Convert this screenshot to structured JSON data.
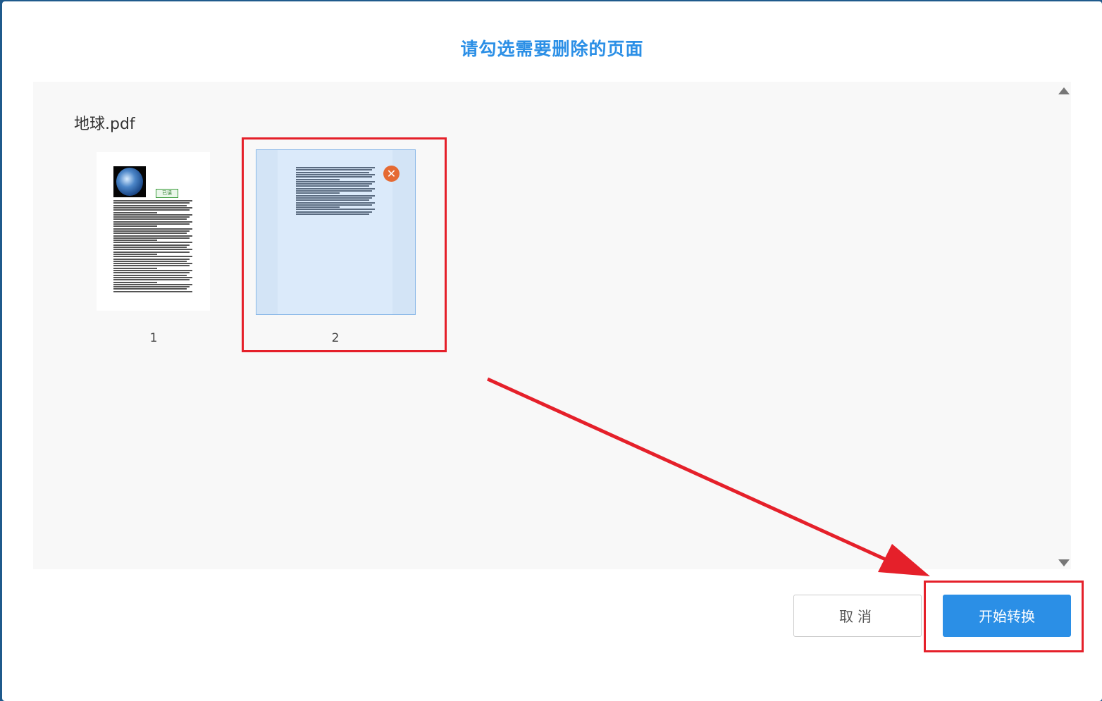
{
  "dialog": {
    "title": "请勾选需要删除的页面"
  },
  "file": {
    "name": "地球.pdf",
    "pages": [
      {
        "number": "1",
        "selected_for_deletion": false
      },
      {
        "number": "2",
        "selected_for_deletion": true
      }
    ],
    "page1_badge": "已读"
  },
  "icons": {
    "delete_mark": "✕",
    "scroll_up": "scroll-up-icon",
    "scroll_down": "scroll-down-icon"
  },
  "buttons": {
    "cancel": "取消",
    "start": "开始转换"
  },
  "colors": {
    "accent": "#2b8fe6",
    "annotation": "#e5202a",
    "delete_mark": "#e56a33"
  }
}
